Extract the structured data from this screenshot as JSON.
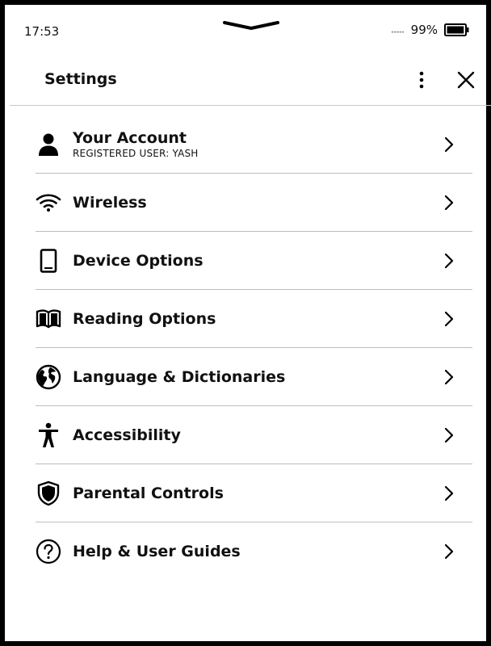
{
  "status_bar": {
    "time": "17:53",
    "signal_dashes": "-----",
    "battery_percent": "99%",
    "battery_level": 0.99
  },
  "header": {
    "title": "Settings",
    "menu_icon": "more-vertical-icon",
    "close_icon": "close-icon"
  },
  "settings": {
    "items": [
      {
        "label": "Your Account",
        "sublabel": "REGISTERED USER: YASH",
        "icon": "person-icon"
      },
      {
        "label": "Wireless",
        "icon": "wifi-icon"
      },
      {
        "label": "Device Options",
        "icon": "device-icon"
      },
      {
        "label": "Reading Options",
        "icon": "book-icon"
      },
      {
        "label": "Language & Dictionaries",
        "icon": "globe-icon"
      },
      {
        "label": "Accessibility",
        "icon": "accessibility-icon"
      },
      {
        "label": "Parental Controls",
        "icon": "shield-icon"
      },
      {
        "label": "Help & User Guides",
        "icon": "help-icon"
      }
    ]
  },
  "colors": {
    "text": "#111111",
    "divider": "#bdbdbd",
    "frame": "#000000",
    "background": "#ffffff"
  }
}
